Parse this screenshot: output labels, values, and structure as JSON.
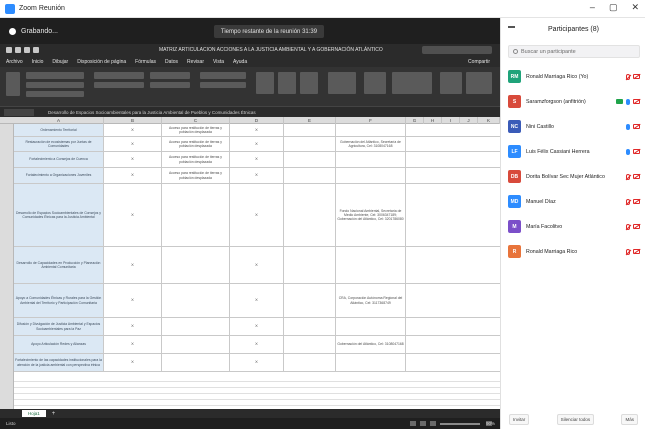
{
  "window": {
    "title": "Zoom Reunión",
    "minimize_icon": "–",
    "maximize_icon": "▢",
    "close_icon": "✕"
  },
  "zoom_bar": {
    "recording_label": "Grabando...",
    "meeting_info": "Tiempo restante de la reunión 31:39"
  },
  "excel": {
    "doc_title": "MATRIZ ARTICULACION ACCIONES A LA JUSTICIA AMBIENTAL Y A GOBERNACIÓN ATLÁNTICO",
    "tabs": [
      "Archivo",
      "Inicio",
      "Dibujar",
      "Disposición de página",
      "Fórmulas",
      "Datos",
      "Revisar",
      "Vista",
      "Ayuda"
    ],
    "share_label": "Compartir",
    "name_box": "B4",
    "formula_text": "Desarrollo de Espacios Socioambientales para la Justicia Ambiental de Pueblos y Comunidades Étnicas",
    "columns": [
      "A",
      "B",
      "C",
      "D",
      "E",
      "F",
      "G",
      "H",
      "I",
      "J",
      "K"
    ],
    "rows": [
      {
        "item": "Ordenamiento Territorial",
        "qty": "X",
        "desc": "Acceso para restitución de tierras y población desplazada",
        "mark": "X",
        "contact": ""
      },
      {
        "item": "Restauración de ecosistemas por Juntas de Comunidades",
        "qty": "X",
        "desc": "Acceso para restitución de tierras y población desplazada",
        "mark": "X",
        "contact": "Gobernación del Atlántico, Secretaría de Agricultura, Cel: 3108047168"
      },
      {
        "item": "Fortalecimiento a Consejos de Cuenca",
        "qty": "X",
        "desc": "Acceso para restitución de tierras y población desplazada",
        "mark": "X",
        "contact": ""
      },
      {
        "item": "Fortalecimiento a Organizaciones Juveniles",
        "qty": "X",
        "desc": "Acceso para restitución de tierras y población desplazada",
        "mark": "X",
        "contact": ""
      },
      {
        "item": "Desarrollo de Espacios Socioambientales de Consejos y Comunidades Étnicas para la Justicia Ambiental",
        "qty": "X",
        "desc": "",
        "mark": "X",
        "contact": "Fondo Nacional Ambiental, Secretaría de Medio Ambiente, Cel: 3006347189; Gobernación del Atlántico, Cel: 3201786080"
      },
      {
        "item": "Desarrollo de Capacidades en Producción y Planeación Ambiental Comunitaria",
        "qty": "X",
        "desc": "",
        "mark": "X",
        "contact": ""
      },
      {
        "item": "Apoyo a Comunidades Étnicas y Rurales para la Gestión Ambiental del Territorio y Participación Comunitaria",
        "qty": "X",
        "desc": "",
        "mark": "X",
        "contact": "CRA, Corporación Autónoma Regional del Atlántico, Cel: 3117368749"
      },
      {
        "item": "Difusión y Divulgación de Justicia Ambiental y Espacios Socioambientales para la Paz",
        "qty": "X",
        "desc": "",
        "mark": "X",
        "contact": ""
      },
      {
        "item": "Apoyo Articulación Redes y Alianzas",
        "qty": "X",
        "desc": "",
        "mark": "X",
        "contact": "Gobernación del Atlántico, Cel: 3108047168"
      },
      {
        "item": "Fortalecimiento de las capacidades institucionales para la atención de la justicia ambiental con perspectiva étnica",
        "qty": "X",
        "desc": "",
        "mark": "X",
        "contact": ""
      }
    ],
    "sheet_tab": "Hoja1",
    "add_sheet": "+",
    "status_text": "Listo",
    "zoom_level": "90%"
  },
  "participants": {
    "title": "Participantes (8)",
    "search_placeholder": "Buscar un participante",
    "list": [
      {
        "initials": "RM",
        "name": "Ronald Marriaga Rico (Yo)",
        "color": "#1fa37a",
        "share": false,
        "mic": "muted",
        "cam": true
      },
      {
        "initials": "S",
        "name": "Saramzforgson (anfitrión)",
        "color": "#d84a3b",
        "share": true,
        "mic": "active",
        "cam": true
      },
      {
        "initials": "NC",
        "name": "Nini Castillo",
        "color": "#3a5bb8",
        "share": false,
        "mic": "active",
        "cam": true
      },
      {
        "initials": "LF",
        "name": "Luis Félix Cassiani Herrera",
        "color": "#2d8cff",
        "share": false,
        "mic": "active",
        "cam": true
      },
      {
        "initials": "DB",
        "name": "Dorita Bolívar Sec Mujer Atlántico",
        "color": "#d84a3b",
        "share": false,
        "mic": "muted",
        "cam": true
      },
      {
        "initials": "MD",
        "name": "Manuel Díaz",
        "color": "#2d8cff",
        "share": false,
        "mic": "muted",
        "cam": true
      },
      {
        "initials": "M",
        "name": "María Facolitvo",
        "color": "#7b4fc9",
        "share": false,
        "mic": "muted",
        "cam": true
      },
      {
        "initials": "R",
        "name": "Ronald Marriaga Rico",
        "color": "#e8743b",
        "share": false,
        "mic": "muted",
        "cam": true
      }
    ],
    "footer": {
      "invite": "Invitar",
      "mute_all": "Silenciar todos",
      "more": "Más"
    }
  }
}
